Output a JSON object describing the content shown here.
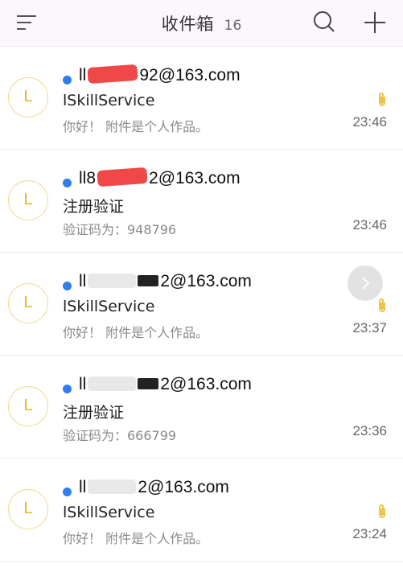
{
  "header": {
    "title": "收件箱",
    "count": "16"
  },
  "icons": {
    "menu": "menu-icon",
    "caret": "chevron-down-icon",
    "search": "search-icon",
    "add": "plus-icon",
    "attachment": "paperclip-icon",
    "swipe": "chevron-right-icon"
  },
  "colors": {
    "unread_dot": "#2e7ef0",
    "avatar_text": "#e6b51d",
    "avatar_border": "#f1d88a",
    "attachment": "#e6b51d"
  },
  "mails": [
    {
      "avatar": "L",
      "sender_prefix": "ll",
      "sender_suffix": "92@163.com",
      "subject": "lSkillService",
      "preview": "你好！ 附件是个人作品。",
      "time": "23:46",
      "unread": true,
      "has_attachment": true
    },
    {
      "avatar": "L",
      "sender_prefix": "ll8",
      "sender_suffix": "2@163.com",
      "subject": "注册验证",
      "preview": "验证码为：948796",
      "time": "23:46",
      "unread": true,
      "has_attachment": false
    },
    {
      "avatar": "L",
      "sender_prefix": "ll",
      "sender_suffix": "2@163.com",
      "subject": "lSkillService",
      "preview": "你好！ 附件是个人作品。",
      "time": "23:37",
      "unread": true,
      "has_attachment": true
    },
    {
      "avatar": "L",
      "sender_prefix": "ll",
      "sender_suffix": "2@163.com",
      "subject": "注册验证",
      "preview": "验证码为：666799",
      "time": "23:36",
      "unread": true,
      "has_attachment": false
    },
    {
      "avatar": "L",
      "sender_prefix": "ll",
      "sender_suffix": "2@163.com",
      "subject": "lSkillService",
      "preview": "你好！ 附件是个人作品。",
      "time": "23:24",
      "unread": true,
      "has_attachment": true
    }
  ]
}
